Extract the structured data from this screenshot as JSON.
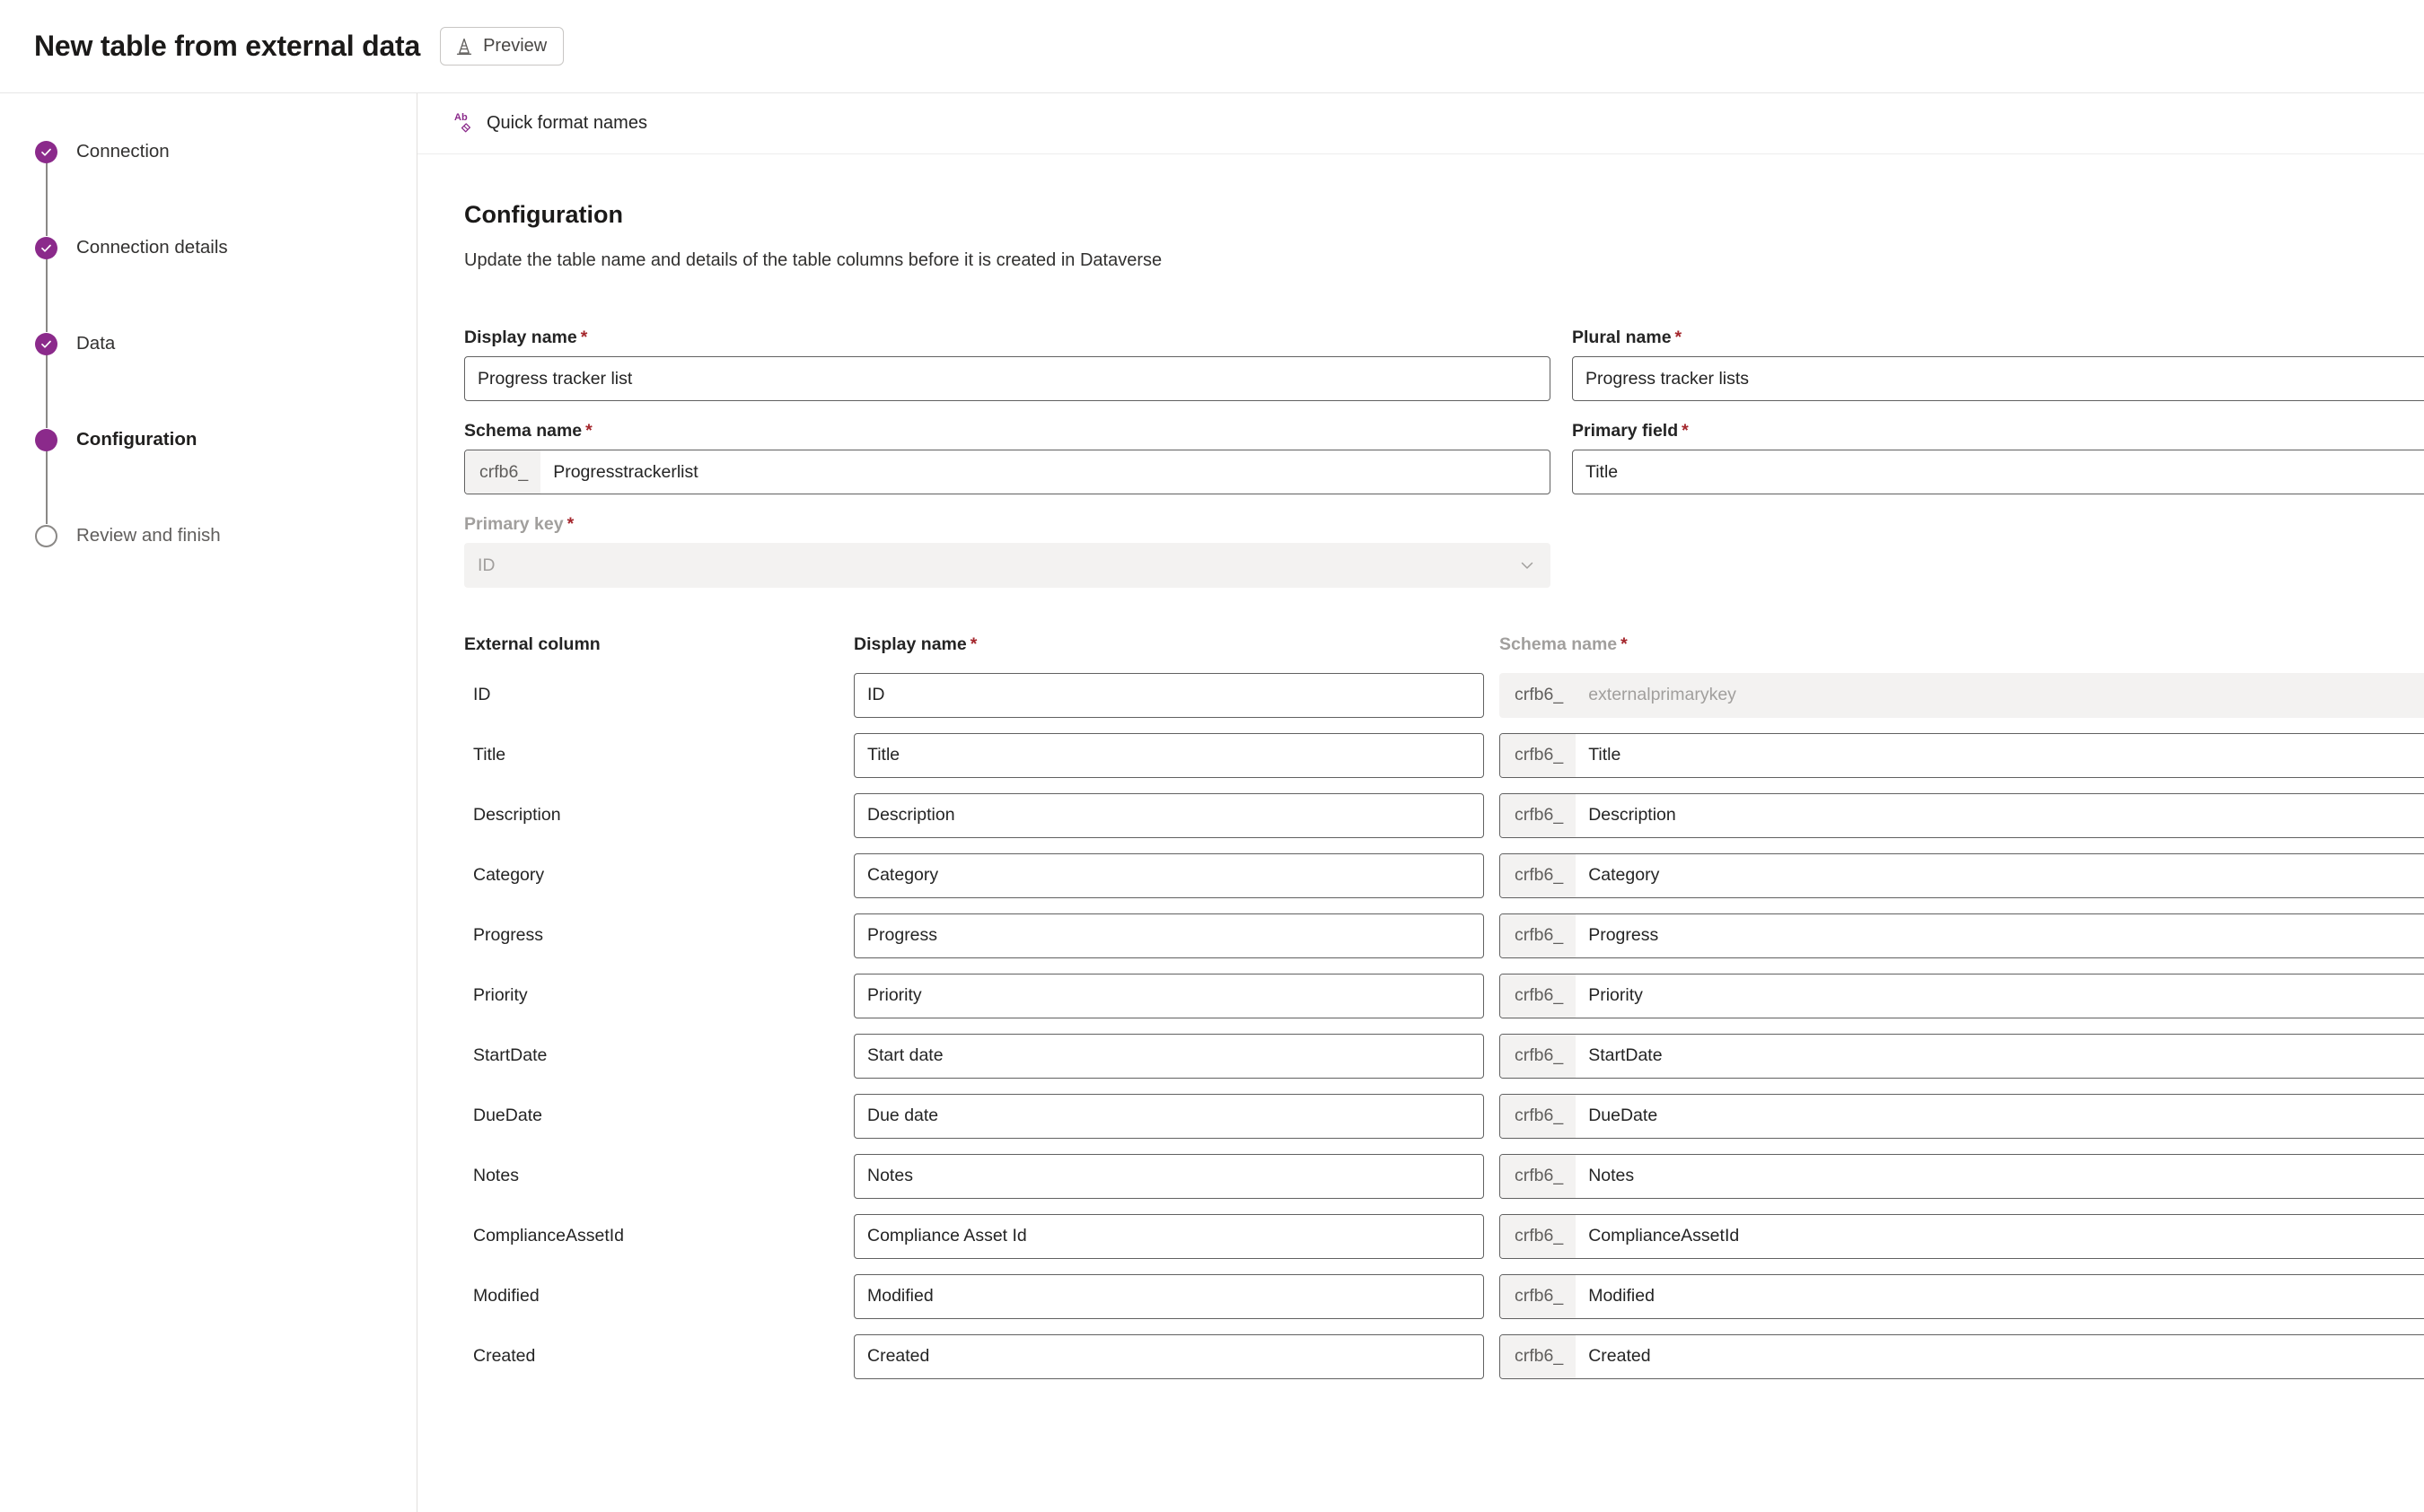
{
  "header": {
    "title": "New table from external data",
    "preview_label": "Preview",
    "preview_icon": "traffic-cone-icon"
  },
  "wizard": {
    "steps": [
      {
        "label": "Connection",
        "state": "complete"
      },
      {
        "label": "Connection details",
        "state": "complete"
      },
      {
        "label": "Data",
        "state": "complete"
      },
      {
        "label": "Configuration",
        "state": "active"
      },
      {
        "label": "Review and finish",
        "state": "pending"
      }
    ]
  },
  "toolbar": {
    "quick_format_label": "Quick format names",
    "quick_format_icon": "text-format-eraser-icon"
  },
  "section": {
    "title": "Configuration",
    "description": "Update the table name and details of the table columns before it is created in Dataverse"
  },
  "form": {
    "display_name": {
      "label": "Display name",
      "required": "*",
      "value": "Progress tracker list"
    },
    "plural_name": {
      "label": "Plural name",
      "required": "*",
      "value": "Progress tracker lists"
    },
    "schema_name": {
      "label": "Schema name",
      "required": "*",
      "prefix": "crfb6_",
      "value": "Progresstrackerlist"
    },
    "primary_field": {
      "label": "Primary field",
      "required": "*",
      "value": "Title"
    },
    "primary_key": {
      "label": "Primary key",
      "required": "*",
      "value": "ID",
      "disabled": true,
      "chevron_icon": "chevron-down-icon"
    }
  },
  "columns_table": {
    "headers": {
      "external_column": "External column",
      "display_name": "Display name",
      "display_name_required": "*",
      "schema_name": "Schema name",
      "schema_name_required": "*"
    },
    "schema_prefix": "crfb6_",
    "rows": [
      {
        "external": "ID",
        "display": "ID",
        "schema": "externalprimarykey",
        "disabled": true
      },
      {
        "external": "Title",
        "display": "Title",
        "schema": "Title",
        "disabled": false
      },
      {
        "external": "Description",
        "display": "Description",
        "schema": "Description",
        "disabled": false
      },
      {
        "external": "Category",
        "display": "Category",
        "schema": "Category",
        "disabled": false
      },
      {
        "external": "Progress",
        "display": "Progress",
        "schema": "Progress",
        "disabled": false
      },
      {
        "external": "Priority",
        "display": "Priority",
        "schema": "Priority",
        "disabled": false
      },
      {
        "external": "StartDate",
        "display": "Start date",
        "schema": "StartDate",
        "disabled": false
      },
      {
        "external": "DueDate",
        "display": "Due date",
        "schema": "DueDate",
        "disabled": false
      },
      {
        "external": "Notes",
        "display": "Notes",
        "schema": "Notes",
        "disabled": false
      },
      {
        "external": "ComplianceAssetId",
        "display": "Compliance Asset Id",
        "schema": "ComplianceAssetId",
        "disabled": false
      },
      {
        "external": "Modified",
        "display": "Modified",
        "schema": "Modified",
        "disabled": false
      },
      {
        "external": "Created",
        "display": "Created",
        "schema": "Created",
        "disabled": false
      }
    ]
  },
  "colors": {
    "accent_purple": "#8b2a8b",
    "required_red": "#a4262c",
    "disabled_gray": "#a19f9d",
    "field_border": "#616161"
  }
}
